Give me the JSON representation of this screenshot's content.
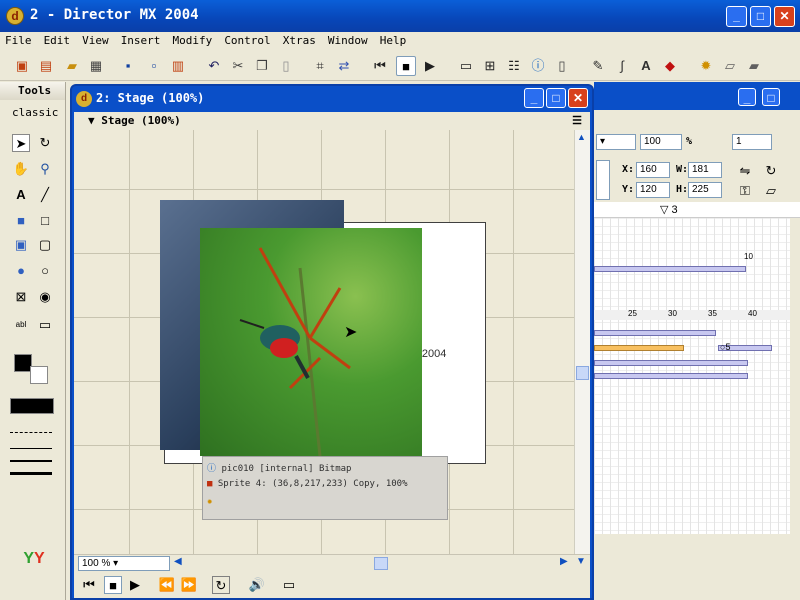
{
  "window": {
    "title": "2 - Director MX 2004",
    "app_icon": "director-icon"
  },
  "menu": [
    "File",
    "Edit",
    "View",
    "Insert",
    "Modify",
    "Control",
    "Xtras",
    "Window",
    "Help"
  ],
  "tools": {
    "header": "Tools",
    "mode": "classic"
  },
  "stage_window": {
    "title": "2: Stage (100%)",
    "header": "Stage (100%)"
  },
  "stage": {
    "text_label": "director 2004",
    "info_lines": [
      "pic010 [internal] Bitmap",
      "Sprite 4: (36,8,217,233) Copy, 100%"
    ]
  },
  "zoom": {
    "value": "100 %"
  },
  "properties": {
    "zoom": "100",
    "percent": "%",
    "channel": "1",
    "x_label": "X:",
    "x": "160",
    "y_label": "Y:",
    "y": "120",
    "w_label": "W:",
    "w": "181",
    "h_label": "H:",
    "h": "225"
  },
  "score": {
    "frame_marker": "3",
    "ruler": [
      "25",
      "30",
      "35",
      "40"
    ],
    "small_marker": "10",
    "marker_5": "5"
  },
  "colors": {
    "accent": "#0a4fc8",
    "sprite_bar": "#c8c8f0",
    "orange_bar": "#f8c060"
  }
}
